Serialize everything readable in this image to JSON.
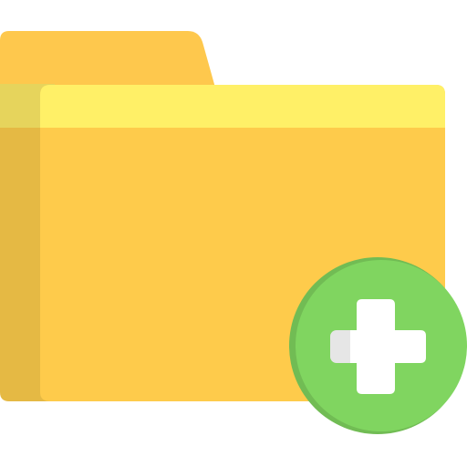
{
  "icon": {
    "name": "add-folder-icon",
    "parts": [
      "folder-icon",
      "plus-circle-icon"
    ],
    "colors": {
      "folder_tab": "#FEC84D",
      "folder_body": "#FECB4B",
      "folder_shadow": "#E5B944",
      "folder_strip": "#FFF067",
      "folder_strip_shadow": "#E6D45C",
      "badge": "#80D560",
      "badge_shadow": "#71BC54",
      "plus": "#FFFFFF",
      "plus_shadow": "#E6E6E6"
    }
  }
}
